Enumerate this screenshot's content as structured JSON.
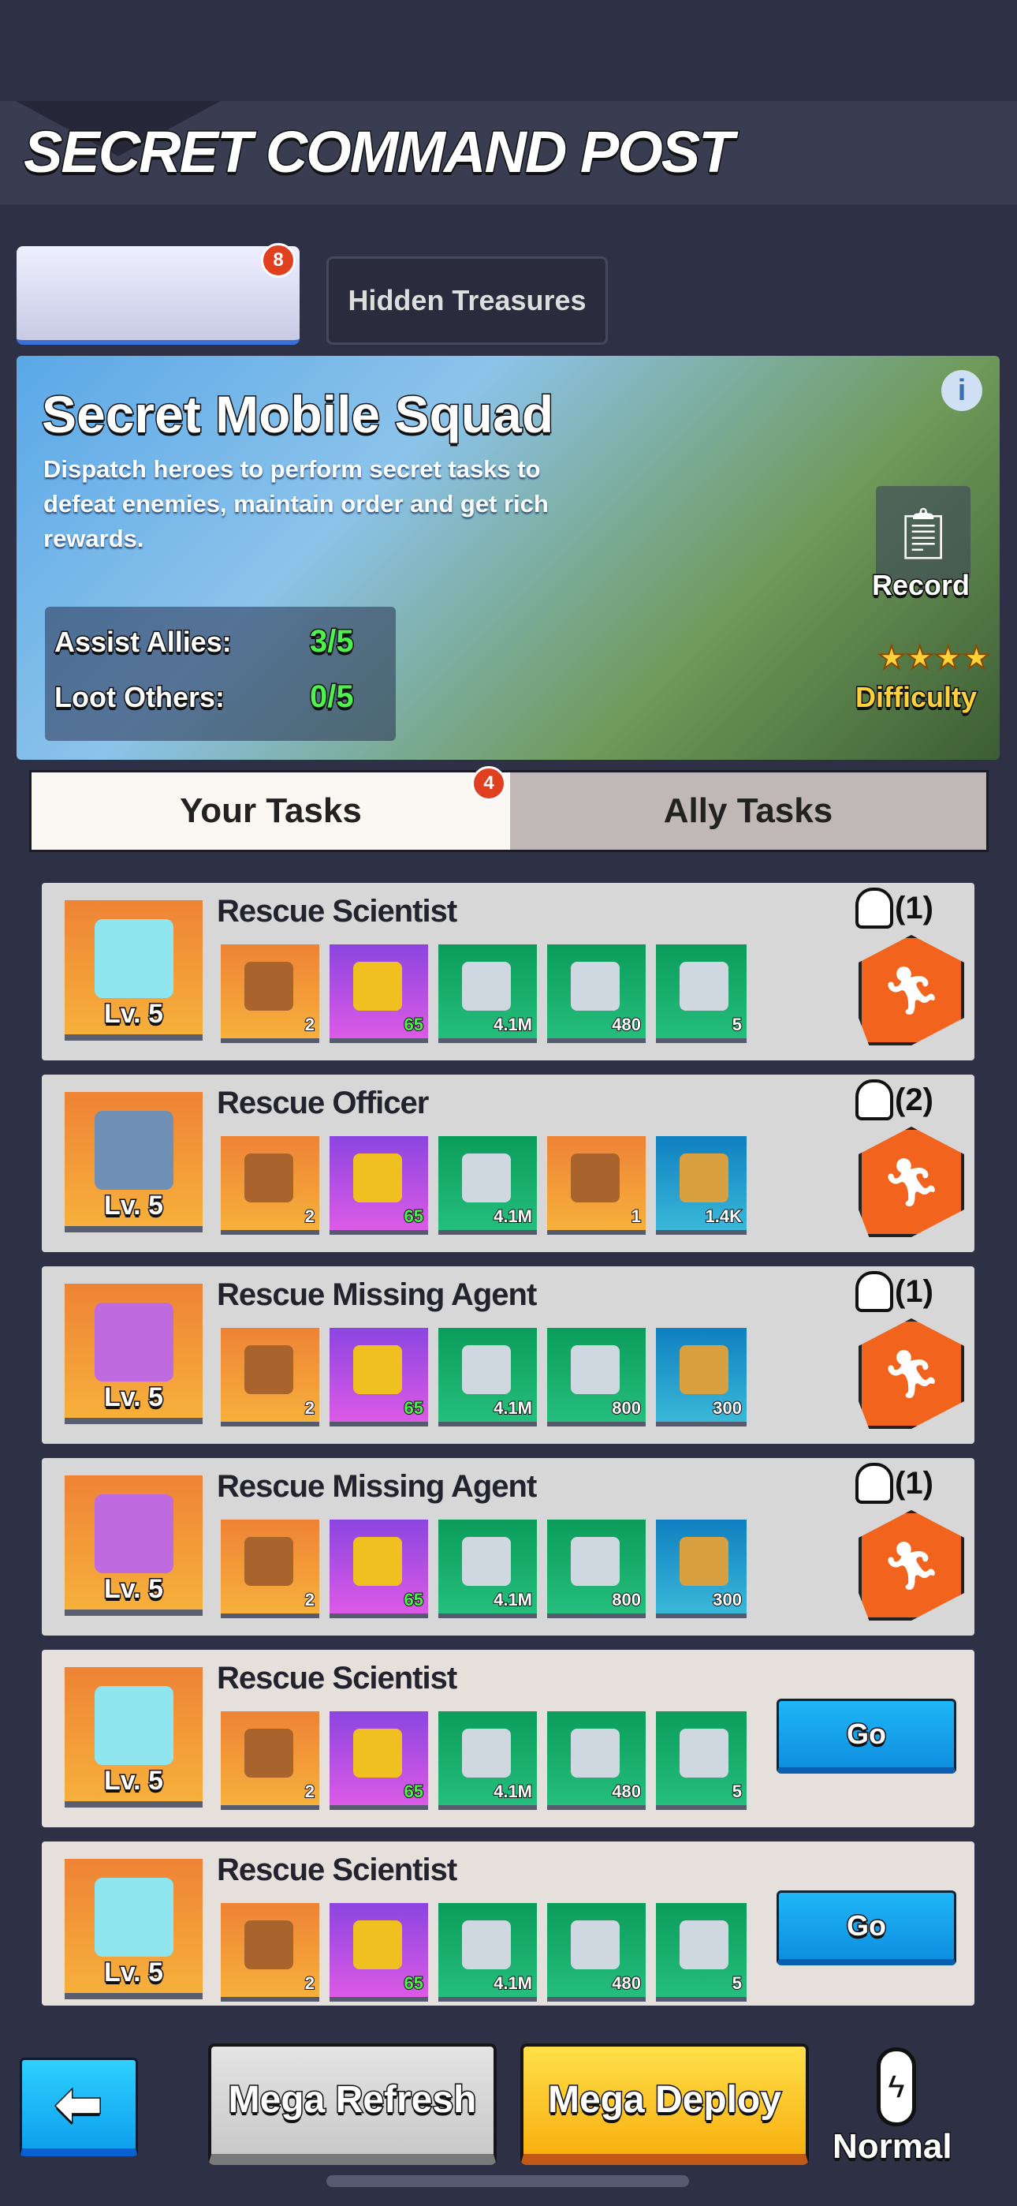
{
  "header": {
    "title": "SECRET COMMAND POST"
  },
  "tabs": [
    {
      "label": "",
      "badge": "8",
      "icon": "jeep-icon"
    },
    {
      "label": "Hidden Treasures"
    }
  ],
  "banner": {
    "title": "Secret Mobile Squad",
    "description": "Dispatch heroes to perform secret tasks to defeat enemies, maintain order and get rich rewards.",
    "stats": [
      {
        "label": "Assist Allies:",
        "value": "3/5"
      },
      {
        "label": "Loot Others:",
        "value": "0/5"
      }
    ],
    "record_label": "Record",
    "difficulty_label": "Difficulty",
    "difficulty_stars": 4
  },
  "task_tabs": [
    {
      "label": "Your Tasks",
      "badge": "4"
    },
    {
      "label": "Ally Tasks"
    }
  ],
  "tasks": [
    {
      "title": "Rescue Scientist",
      "level": "Lv. 5",
      "icon": "blueprint",
      "helpers": "(1)",
      "action": "assist",
      "rewards": [
        {
          "c": "orange",
          "n": "2"
        },
        {
          "c": "purple",
          "n": "65"
        },
        {
          "c": "green",
          "n": "4.1M"
        },
        {
          "c": "green",
          "n": "480"
        },
        {
          "c": "green",
          "n": "5"
        }
      ]
    },
    {
      "title": "Rescue Officer",
      "level": "Lv. 5",
      "icon": "target",
      "helpers": "(2)",
      "action": "assist",
      "rewards": [
        {
          "c": "orange",
          "n": "2"
        },
        {
          "c": "purple",
          "n": "65"
        },
        {
          "c": "green",
          "n": "4.1M"
        },
        {
          "c": "orange",
          "n": "1"
        },
        {
          "c": "blue",
          "n": "1.4K"
        }
      ]
    },
    {
      "title": "Rescue Missing Agent",
      "level": "Lv. 5",
      "icon": "folder",
      "helpers": "(1)",
      "action": "assist",
      "rewards": [
        {
          "c": "orange",
          "n": "2"
        },
        {
          "c": "purple",
          "n": "65"
        },
        {
          "c": "green",
          "n": "4.1M"
        },
        {
          "c": "green",
          "n": "800"
        },
        {
          "c": "blue",
          "n": "300"
        }
      ]
    },
    {
      "title": "Rescue Missing Agent",
      "level": "Lv. 5",
      "icon": "folder",
      "helpers": "(1)",
      "action": "assist",
      "rewards": [
        {
          "c": "orange",
          "n": "2"
        },
        {
          "c": "purple",
          "n": "65"
        },
        {
          "c": "green",
          "n": "4.1M"
        },
        {
          "c": "green",
          "n": "800"
        },
        {
          "c": "blue",
          "n": "300"
        }
      ]
    },
    {
      "title": "Rescue Scientist",
      "level": "Lv. 5",
      "icon": "blueprint",
      "action": "go",
      "go_label": "Go",
      "rewards": [
        {
          "c": "orange",
          "n": "2"
        },
        {
          "c": "purple",
          "n": "65"
        },
        {
          "c": "green",
          "n": "4.1M"
        },
        {
          "c": "green",
          "n": "480"
        },
        {
          "c": "green",
          "n": "5"
        }
      ]
    },
    {
      "title": "Rescue Scientist",
      "level": "Lv. 5",
      "icon": "blueprint",
      "action": "go",
      "go_label": "Go",
      "rewards": [
        {
          "c": "orange",
          "n": "2"
        },
        {
          "c": "purple",
          "n": "65"
        },
        {
          "c": "green",
          "n": "4.1M"
        },
        {
          "c": "green",
          "n": "480"
        },
        {
          "c": "green",
          "n": "5"
        }
      ]
    }
  ],
  "footer": {
    "refresh_label": "Mega Refresh",
    "deploy_label": "Mega Deploy",
    "mode_label": "Normal"
  }
}
